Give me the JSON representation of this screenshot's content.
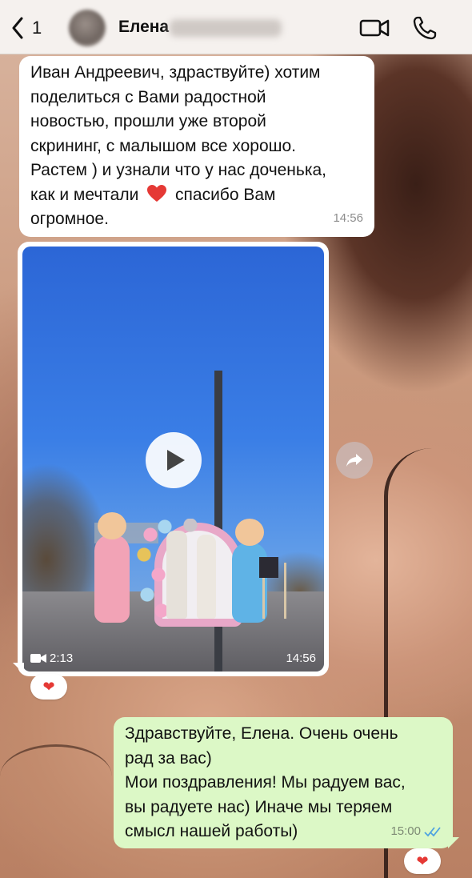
{
  "header": {
    "back_count": "1",
    "contact_name": "Елена"
  },
  "messages": [
    {
      "direction": "incoming",
      "lines": [
        "Иван Андреевич, здраствуйте) хотим",
        "поделиться с Вами радостной",
        "новостью, прошли уже второй",
        "скрининг, с малышом все хорошо.",
        "Растем ) и узнали что у нас доченька,",
        "как и мечтали",
        "спасибо Вам",
        "огромное."
      ],
      "emoji": "heart",
      "time": "14:56"
    },
    {
      "direction": "incoming",
      "type": "video",
      "duration": "2:13",
      "time": "14:56",
      "reaction": "❤"
    },
    {
      "direction": "outgoing",
      "lines": [
        "Здравствуйте, Елена. Очень очень",
        "рад за вас)",
        "Мои поздравления! Мы радуем вас,",
        "вы радуете нас) Иначе мы теряем",
        "смысл нашей работы)"
      ],
      "time": "15:00",
      "status": "read",
      "reaction": "❤"
    }
  ],
  "colors": {
    "incoming_bubble": "#ffffff",
    "outgoing_bubble": "#dcf8c6",
    "read_ticks": "#4fa3e0",
    "heart": "#e53935"
  },
  "icons": {
    "back": "chevron-left-icon",
    "video_call": "video-camera-icon",
    "phone": "phone-icon",
    "play": "play-icon",
    "forward": "share-arrow-icon",
    "video_duration": "video-camera-small-icon",
    "read_status": "double-check-icon"
  }
}
